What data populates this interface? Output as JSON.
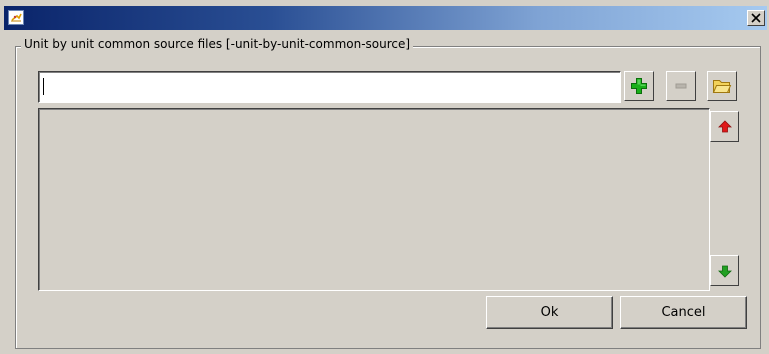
{
  "window": {
    "title": "",
    "icon": "app-logo-icon",
    "close_icon": "close-x-icon"
  },
  "group": {
    "legend": "Unit by unit common source files [-unit-by-unit-common-source]"
  },
  "path_field": {
    "value": "",
    "placeholder": ""
  },
  "toolbar": {
    "add_icon": "green-plus-icon",
    "remove_icon": "minus-icon",
    "browse_icon": "folder-open-icon"
  },
  "list": {
    "items": [],
    "move_up_icon": "red-up-arrow-icon",
    "move_down_icon": "green-down-arrow-icon"
  },
  "buttons": {
    "ok_label": "Ok",
    "cancel_label": "Cancel"
  },
  "colors": {
    "dialog_bg": "#d4d0c8",
    "title_gradient_start": "#0a246a",
    "title_gradient_end": "#a6caf0",
    "add_green": "#19b019",
    "up_red": "#e01818",
    "down_green": "#22a022",
    "folder_yellow": "#f2d25a"
  }
}
